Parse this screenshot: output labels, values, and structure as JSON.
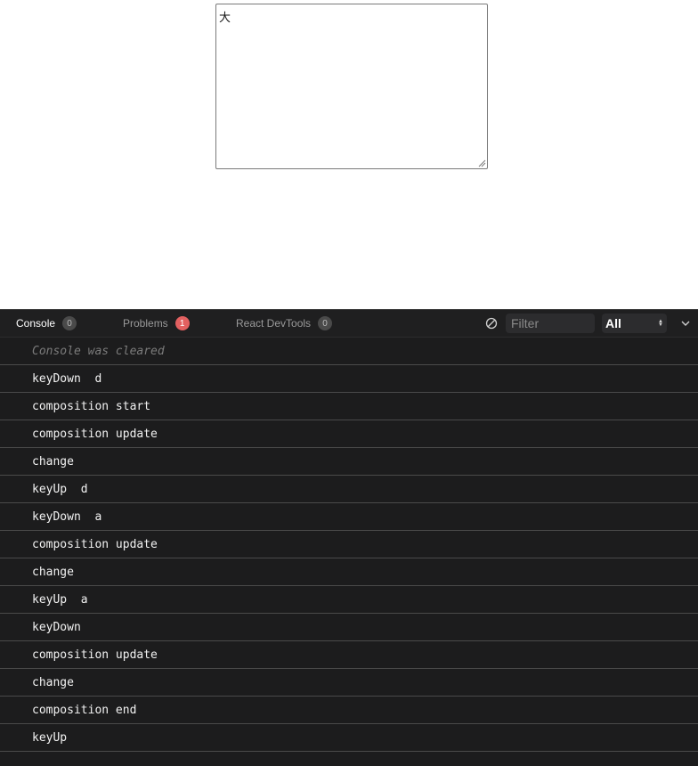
{
  "preview": {
    "textarea_value": "大"
  },
  "devtools": {
    "tabs": [
      {
        "label": "Console",
        "count": "0"
      },
      {
        "label": "Problems",
        "count": "1"
      },
      {
        "label": "React DevTools",
        "count": "0"
      }
    ],
    "filter_placeholder": "Filter",
    "level_selected": "All",
    "colors": {
      "panel_bg": "#1c1c1d",
      "error_badge": "#e26060",
      "divider": "#4a4a4a"
    }
  },
  "console": {
    "cleared_message": "Console was cleared",
    "entries": [
      "keyDown  d",
      "composition start",
      "composition update",
      "change",
      "keyUp  d",
      "keyDown  a",
      "composition update",
      "change",
      "keyUp  a",
      "keyDown",
      "composition update",
      "change",
      "composition end",
      "keyUp"
    ]
  }
}
